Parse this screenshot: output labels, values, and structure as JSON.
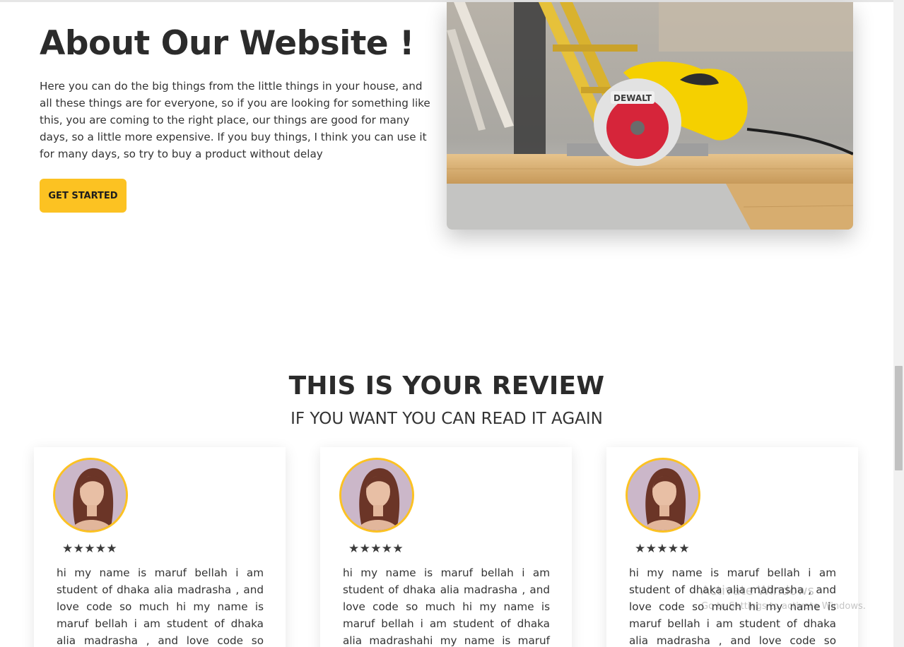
{
  "about": {
    "title": "About Our Website !",
    "text": "Here you can do the big things from the little things in your house, and all these things are for everyone, so if you are looking for something like this, you are coming to the right place, our things are good for many days, so a little more expensive. If you buy things, I think you can use it for many days, so try to buy a product without delay",
    "button_label": "GET STARTED",
    "image_label": "DEWALT",
    "accent_color": "#fcc222"
  },
  "reviews": {
    "title": "THIS IS YOUR REVIEW",
    "subtitle": "IF YOU WANT YOU CAN READ IT AGAIN",
    "stars": "★★★★★",
    "rating": 5,
    "cards": [
      {
        "text": "hi my name is maruf bellah i am student of dhaka alia madrasha , and love code so much hi my name is maruf bellah i am student of dhaka alia madrasha , and love code so much hi my name is maruf"
      },
      {
        "text": "hi my name is maruf bellah i am student of dhaka alia madrasha , and love code so much hi my name is maruf bellah i am student of dhaka alia madrashahi my name is maruf bellah i am student of"
      },
      {
        "text": "hi my name is maruf bellah i am student of dhaka alia madrasha , and love code so much hi my name is maruf bellah i am student of dhaka alia madrasha , and love code so much hi my name is maruf"
      }
    ]
  },
  "watermark": {
    "line1": "Activate Windows",
    "line2": "Go to Settings to activate Windows."
  }
}
